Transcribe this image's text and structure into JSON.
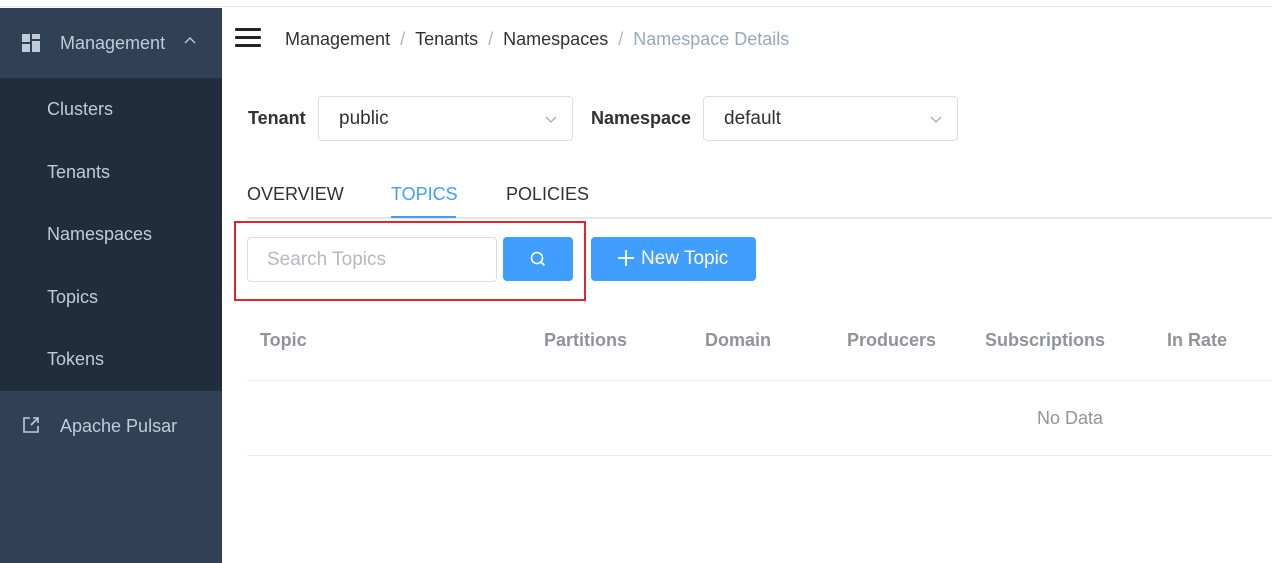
{
  "sidebar": {
    "group": {
      "label": "Management",
      "icon": "dashboard-grid-icon"
    },
    "items": [
      {
        "label": "Clusters"
      },
      {
        "label": "Tenants"
      },
      {
        "label": "Namespaces"
      },
      {
        "label": "Topics"
      },
      {
        "label": "Tokens"
      }
    ],
    "external_link": {
      "label": "Apache Pulsar",
      "icon": "external-link-icon"
    }
  },
  "header": {
    "breadcrumb": [
      "Management",
      "Tenants",
      "Namespaces",
      "Namespace Details"
    ],
    "separator": "/"
  },
  "filters": {
    "tenant_label": "Tenant",
    "tenant_value": "public",
    "namespace_label": "Namespace",
    "namespace_value": "default"
  },
  "tabs": [
    {
      "label": "OVERVIEW",
      "active": false
    },
    {
      "label": "TOPICS",
      "active": true
    },
    {
      "label": "POLICIES",
      "active": false
    }
  ],
  "toolbar": {
    "search_placeholder": "Search Topics",
    "search_value": "",
    "new_button_label": "New Topic"
  },
  "table": {
    "columns": [
      "Topic",
      "Partitions",
      "Domain",
      "Producers",
      "Subscriptions",
      "In Rate"
    ],
    "rows": [],
    "empty_text": "No Data"
  },
  "colors": {
    "sidebar_bg": "#304156",
    "sidebar_submenu_bg": "#1f2d3d",
    "primary": "#409eff",
    "highlight_box": "#e0262b"
  }
}
